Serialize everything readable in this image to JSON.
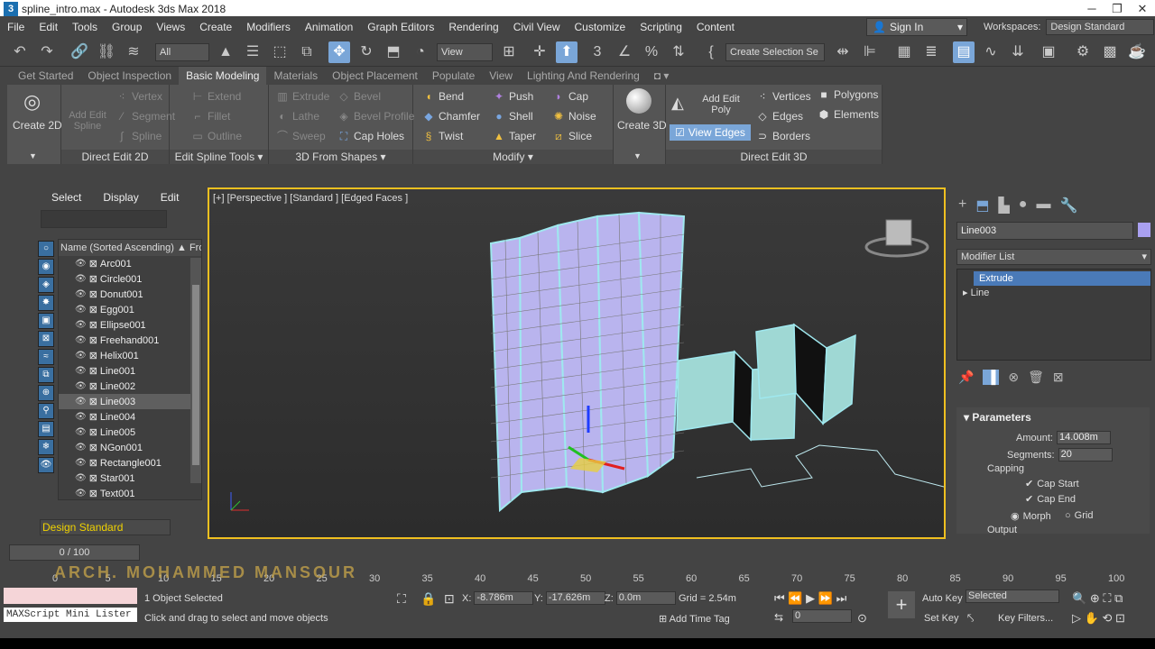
{
  "window": {
    "title": "spline_intro.max - Autodesk 3ds Max 2018",
    "logo": "3"
  },
  "menu": [
    "File",
    "Edit",
    "Tools",
    "Group",
    "Views",
    "Create",
    "Modifiers",
    "Animation",
    "Graph Editors",
    "Rendering",
    "Civil View",
    "Customize",
    "Scripting",
    "Content"
  ],
  "signin": "Sign In",
  "workspaces": {
    "label": "Workspaces:",
    "value": "Design Standard"
  },
  "toolbar": {
    "filter": "All",
    "view": "View",
    "selection_set": "Create Selection Se"
  },
  "ribbon_tabs": [
    "Get Started",
    "Object Inspection",
    "Basic Modeling",
    "Materials",
    "Object Placement",
    "Populate",
    "View",
    "Lighting And Rendering"
  ],
  "ribbon": {
    "create2d": "Create 2D",
    "add_edit_spline": "Add Edit Spline",
    "vertex": "Vertex",
    "segment": "Segment",
    "spline": "Spline",
    "extend": "Extend",
    "fillet": "Fillet",
    "outline": "Outline",
    "extrude": "Extrude",
    "lathe": "Lathe",
    "sweep": "Sweep",
    "bevel": "Bevel",
    "bevel_profile": "Bevel Profile",
    "cap_holes": "Cap Holes",
    "bend": "Bend",
    "chamfer": "Chamfer",
    "twist": "Twist",
    "push": "Push",
    "shell": "Shell",
    "taper": "Taper",
    "cap": "Cap",
    "noise": "Noise",
    "slice": "Slice",
    "create3d": "Create 3D",
    "add_edit_poly": "Add Edit Poly",
    "view_edges": "View Edges",
    "vertices": "Vertices",
    "edges": "Edges",
    "borders": "Borders",
    "polygons": "Polygons",
    "elements": "Elements",
    "g1": "Direct Edit 2D",
    "g2": "Edit Spline Tools",
    "g3": "3D From Shapes",
    "g4": "Modify",
    "g5": "Direct Edit 3D"
  },
  "scene_explorer": {
    "tabs": [
      "Select",
      "Display",
      "Edit"
    ],
    "header": "Name (Sorted Ascending)",
    "header2": "Froz",
    "items": [
      "Arc001",
      "Circle001",
      "Donut001",
      "Egg001",
      "Ellipse001",
      "Freehand001",
      "Helix001",
      "Line001",
      "Line002",
      "Line003",
      "Line004",
      "Line005",
      "NGon001",
      "Rectangle001",
      "Star001",
      "Text001"
    ],
    "selected": "Line003",
    "workspace": "Design Standard"
  },
  "viewport": {
    "label": "[+] [Perspective ] [Standard ] [Edged Faces ]"
  },
  "command_panel": {
    "object_name": "Line003",
    "modifier_list": "Modifier List",
    "stack": [
      "Extrude",
      "Line"
    ],
    "rollout": "Parameters",
    "amount_label": "Amount:",
    "amount": "14.008m",
    "segments_label": "Segments:",
    "segments": "20",
    "capping": "Capping",
    "cap_start": "Cap Start",
    "cap_end": "Cap End",
    "morph": "Morph",
    "grid": "Grid",
    "output": "Output",
    "color": "#a9a0f0"
  },
  "timeline": {
    "frame": "0 / 100",
    "ticks": [
      "0",
      "5",
      "10",
      "15",
      "20",
      "25",
      "30",
      "35",
      "40",
      "45",
      "50",
      "55",
      "60",
      "65",
      "70",
      "75",
      "80",
      "85",
      "90",
      "95",
      "100"
    ]
  },
  "watermark": "ARCH. MOHAMMED MANSOUR",
  "status": {
    "selected": "1 Object Selected",
    "hint": "Click and drag to select and move objects",
    "maxscript": "MAXScript Mini Lister",
    "x_label": "X:",
    "x": "-8.786m",
    "y_label": "Y:",
    "y": "-17.626m",
    "z_label": "Z:",
    "z": "0.0m",
    "grid": "Grid = 2.54m",
    "add_time_tag": "Add Time Tag",
    "auto_key": "Auto Key",
    "set_key": "Set Key",
    "key_mode": "Selected",
    "key_filters": "Key Filters...",
    "frame_field": "0"
  }
}
